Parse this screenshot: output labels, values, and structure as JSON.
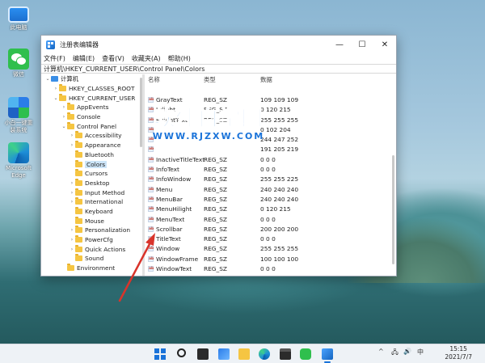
{
  "desktop_icons": [
    {
      "label": "此电脑",
      "icon": "this-pc-icon"
    },
    {
      "label": "微信",
      "icon": "wechat-icon"
    },
    {
      "label": "小白一键重装系统",
      "icon": "upgrade-tool-icon"
    },
    {
      "label": "Microsoft Edge",
      "icon": "edge-icon"
    }
  ],
  "window": {
    "title": "注册表编辑器",
    "menu": [
      "文件(F)",
      "编辑(E)",
      "查看(V)",
      "收藏夹(A)",
      "帮助(H)"
    ],
    "address": "计算机\\HKEY_CURRENT_USER\\Control Panel\\Colors",
    "controls": {
      "minimize": "—",
      "maximize": "☐",
      "close": "✕"
    }
  },
  "tree": {
    "rows": [
      {
        "label": "计算机",
        "level": 0,
        "expander": "⌄",
        "icon": "computer"
      },
      {
        "label": "HKEY_CLASSES_ROOT",
        "level": 1,
        "expander": "›",
        "icon": "folder"
      },
      {
        "label": "HKEY_CURRENT_USER",
        "level": 1,
        "expander": "⌄",
        "icon": "folder"
      },
      {
        "label": "AppEvents",
        "level": 2,
        "expander": "›",
        "icon": "folder"
      },
      {
        "label": "Console",
        "level": 2,
        "expander": "›",
        "icon": "folder"
      },
      {
        "label": "Control Panel",
        "level": 2,
        "expander": "⌄",
        "icon": "folder"
      },
      {
        "label": "Accessibility",
        "level": 3,
        "expander": "›",
        "icon": "folder"
      },
      {
        "label": "Appearance",
        "level": 3,
        "expander": "›",
        "icon": "folder"
      },
      {
        "label": "Bluetooth",
        "level": 3,
        "expander": "",
        "icon": "folder"
      },
      {
        "label": "Colors",
        "level": 3,
        "expander": "",
        "icon": "folder",
        "selected": true
      },
      {
        "label": "Cursors",
        "level": 3,
        "expander": "",
        "icon": "folder"
      },
      {
        "label": "Desktop",
        "level": 3,
        "expander": "›",
        "icon": "folder"
      },
      {
        "label": "Input Method",
        "level": 3,
        "expander": "›",
        "icon": "folder"
      },
      {
        "label": "International",
        "level": 3,
        "expander": "›",
        "icon": "folder"
      },
      {
        "label": "Keyboard",
        "level": 3,
        "expander": "",
        "icon": "folder"
      },
      {
        "label": "Mouse",
        "level": 3,
        "expander": "",
        "icon": "folder"
      },
      {
        "label": "Personalization",
        "level": 3,
        "expander": "›",
        "icon": "folder"
      },
      {
        "label": "PowerCfg",
        "level": 3,
        "expander": "›",
        "icon": "folder"
      },
      {
        "label": "Quick Actions",
        "level": 3,
        "expander": "›",
        "icon": "folder"
      },
      {
        "label": "Sound",
        "level": 3,
        "expander": "",
        "icon": "folder"
      },
      {
        "label": "Environment",
        "level": 2,
        "expander": "",
        "icon": "folder"
      }
    ]
  },
  "values": {
    "headers": {
      "name": "名称",
      "type": "类型",
      "data": "数据"
    },
    "rows": [
      {
        "name": "",
        "type": "",
        "data": ""
      },
      {
        "name": "GrayText",
        "type": "REG_SZ",
        "data": "109 109 109"
      },
      {
        "name": "Hilight",
        "type": "REG_SZ",
        "data": "0 120 215"
      },
      {
        "name": "HilightText",
        "type": "REG_SZ",
        "data": "255 255 255"
      },
      {
        "name": "",
        "type": "",
        "data": "0 102 204"
      },
      {
        "name": "",
        "type": "",
        "data": "244 247 252"
      },
      {
        "name": "",
        "type": "",
        "data": "191 205 219"
      },
      {
        "name": "InactiveTitleText",
        "type": "REG_SZ",
        "data": "0 0 0"
      },
      {
        "name": "InfoText",
        "type": "REG_SZ",
        "data": "0 0 0"
      },
      {
        "name": "InfoWindow",
        "type": "REG_SZ",
        "data": "255 255 225"
      },
      {
        "name": "Menu",
        "type": "REG_SZ",
        "data": "240 240 240"
      },
      {
        "name": "MenuBar",
        "type": "REG_SZ",
        "data": "240 240 240"
      },
      {
        "name": "MenuHilight",
        "type": "REG_SZ",
        "data": "0 120 215"
      },
      {
        "name": "MenuText",
        "type": "REG_SZ",
        "data": "0 0 0"
      },
      {
        "name": "Scrollbar",
        "type": "REG_SZ",
        "data": "200 200 200"
      },
      {
        "name": "TitleText",
        "type": "REG_SZ",
        "data": "0 0 0"
      },
      {
        "name": "Window",
        "type": "REG_SZ",
        "data": "255 255 255"
      },
      {
        "name": "WindowFrame",
        "type": "REG_SZ",
        "data": "100 100 100"
      },
      {
        "name": "WindowText",
        "type": "REG_SZ",
        "data": "0 0 0"
      }
    ]
  },
  "watermark": {
    "title": "软件自学网",
    "url": "WWW.RJZXW.COM"
  },
  "taskbar": {
    "apps": [
      "start-icon",
      "search-icon",
      "task-view-icon",
      "widgets-icon",
      "file-explorer-icon",
      "edge-icon",
      "store-icon",
      "wechat-icon",
      "regedit-icon"
    ],
    "tray": {
      "chevron": "^",
      "network": "🖧",
      "volume": "🔊",
      "ime": "中"
    },
    "time": "15:15",
    "date": "2021/7/7"
  },
  "colors": {
    "accent": "#1a73d9",
    "arrow": "#d9342b",
    "selection": "#cce4f7"
  }
}
